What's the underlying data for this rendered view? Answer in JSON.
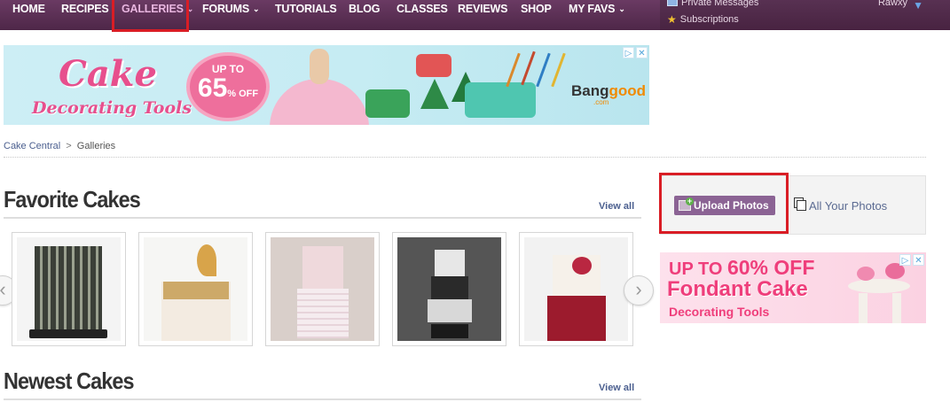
{
  "nav": {
    "items": [
      {
        "label": "HOME",
        "caret": false
      },
      {
        "label": "RECIPES",
        "caret": false
      },
      {
        "label": "GALLERIES",
        "caret": true
      },
      {
        "label": "FORUMS",
        "caret": true
      },
      {
        "label": "TUTORIALS",
        "caret": false
      },
      {
        "label": "BLOG",
        "caret": false
      },
      {
        "label": "CLASSES",
        "caret": false
      },
      {
        "label": "REVIEWS",
        "caret": false
      },
      {
        "label": "SHOP",
        "caret": false
      },
      {
        "label": "MY FAVS",
        "caret": true
      }
    ],
    "caret_glyph": "⌄"
  },
  "user_menu": {
    "private_messages": "Private Messages",
    "subscriptions": "Subscriptions",
    "username": "Rawxy"
  },
  "ad_main": {
    "title_line1": "Cake",
    "title_line2": "Decorating Tools",
    "badge_top": "UP TO",
    "badge_value": "65",
    "badge_unit": "% OFF",
    "brand": "Bang",
    "brand_accent": "good",
    "brand_sub": ".com"
  },
  "breadcrumb": {
    "home": "Cake Central",
    "separator": ">",
    "current": "Galleries"
  },
  "favorite": {
    "title": "Favorite Cakes",
    "view_all": "View all"
  },
  "newest": {
    "title": "Newest Cakes",
    "view_all": "View all"
  },
  "carousel": {
    "prev_glyph": "‹",
    "next_glyph": "›"
  },
  "sidebar": {
    "upload_label": "Upload Photos",
    "all_photos_label": "All Your Photos"
  },
  "ad_side": {
    "line1_prefix": "UP TO ",
    "line1_value": "60% OFF",
    "line2": "Fondant Cake",
    "line3": "Decorating Tools"
  },
  "colors": {
    "nav_bg": "#5c2f56",
    "accent_purple": "#8b6394",
    "highlight_red": "#d91d25",
    "link_blue": "#4b5f8f",
    "ad_pink": "#e74f8d"
  }
}
